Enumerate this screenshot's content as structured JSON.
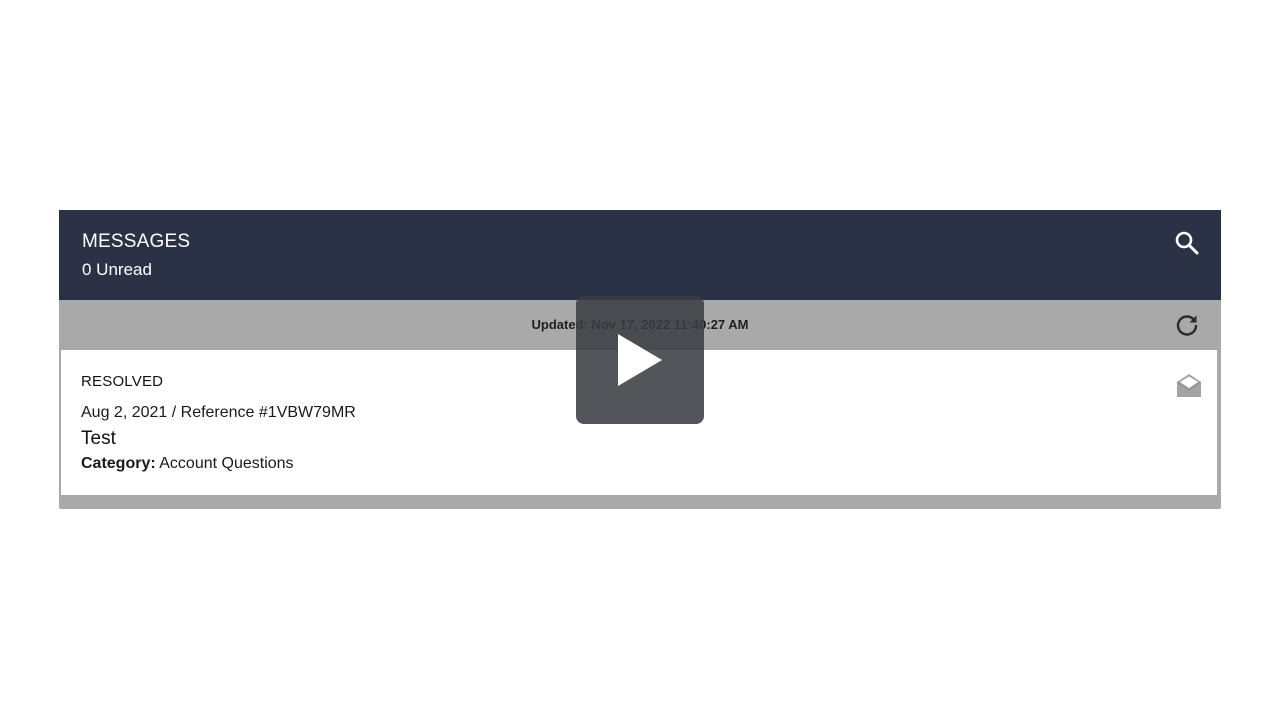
{
  "header": {
    "title": "MESSAGES",
    "unread": "0 Unread",
    "search_icon": "search-icon"
  },
  "status_bar": {
    "updated": "Updated: Nov 17, 2022 11:40:27 AM",
    "refresh_icon": "refresh-icon"
  },
  "messages": [
    {
      "status": "RESOLVED",
      "meta": "Aug 2, 2021 / Reference #1VBW79MR",
      "subject": "Test",
      "category_label": "Category:",
      "category_value": "Account Questions",
      "icon": "envelope-open-icon"
    }
  ],
  "overlay": {
    "icon": "play-icon"
  },
  "colors": {
    "header_bg": "#2b3245",
    "status_bar_bg": "#a9a9a9",
    "card_bg": "#ffffff",
    "overlay_bg": "#3a3e42"
  }
}
